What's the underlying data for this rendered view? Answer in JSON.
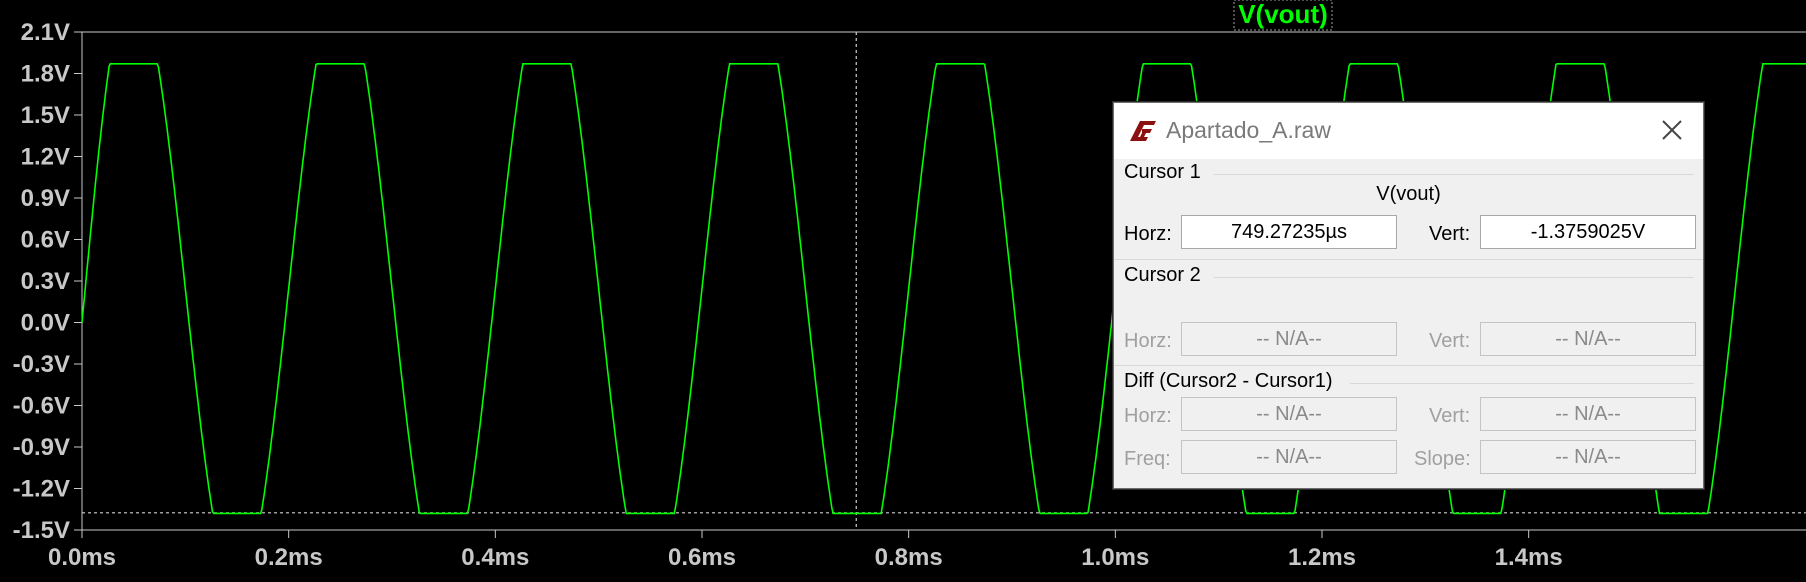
{
  "plot": {
    "trace_name": "V(vout)",
    "trace_color": "#00ff00",
    "background": "#000000",
    "y_ticks": [
      "2.1V",
      "1.8V",
      "1.5V",
      "1.2V",
      "0.9V",
      "0.6V",
      "0.3V",
      "0.0V",
      "-0.3V",
      "-0.6V",
      "-0.9V",
      "-1.2V",
      "-1.5V"
    ],
    "x_ticks": [
      "0.0ms",
      "0.2ms",
      "0.4ms",
      "0.6ms",
      "0.8ms",
      "1.0ms",
      "1.2ms",
      "1.4ms"
    ],
    "cursor": {
      "time_ms": 0.74927235,
      "voltage": -1.3759025
    }
  },
  "chart_data": {
    "type": "line",
    "title": "V(vout)",
    "xlabel": "",
    "ylabel": "",
    "xlim": [
      0,
      1.43
    ],
    "ylim": [
      -1.5,
      2.1
    ],
    "series": [
      {
        "name": "V(vout)",
        "x": [
          0,
          0.05,
          0.15,
          0.25,
          0.35,
          0.45,
          0.55,
          0.65,
          0.75,
          0.85,
          0.95,
          1.05,
          1.15,
          1.25,
          1.35
        ],
        "values": [
          0.0,
          1.87,
          -1.38,
          1.87,
          -1.38,
          1.87,
          -1.38,
          1.87,
          -1.38,
          1.87,
          -1.38,
          1.87,
          -1.38,
          1.87,
          -1.38
        ]
      }
    ],
    "period_ms": 0.2,
    "grid": false
  },
  "dialog": {
    "title": "Apartado_A.raw",
    "cursor1": {
      "label": "Cursor 1",
      "trace": "V(vout)",
      "horz_label": "Horz:",
      "horz_value": "749.27235µs",
      "vert_label": "Vert:",
      "vert_value": "-1.3759025V"
    },
    "cursor2": {
      "label": "Cursor 2",
      "horz_label": "Horz:",
      "horz_value": "-- N/A--",
      "vert_label": "Vert:",
      "vert_value": "-- N/A--"
    },
    "diff": {
      "label": "Diff (Cursor2 - Cursor1)",
      "horz_label": "Horz:",
      "horz_value": "-- N/A--",
      "vert_label": "Vert:",
      "vert_value": "-- N/A--",
      "freq_label": "Freq:",
      "freq_value": "-- N/A--",
      "slope_label": "Slope:",
      "slope_value": "-- N/A--"
    }
  }
}
